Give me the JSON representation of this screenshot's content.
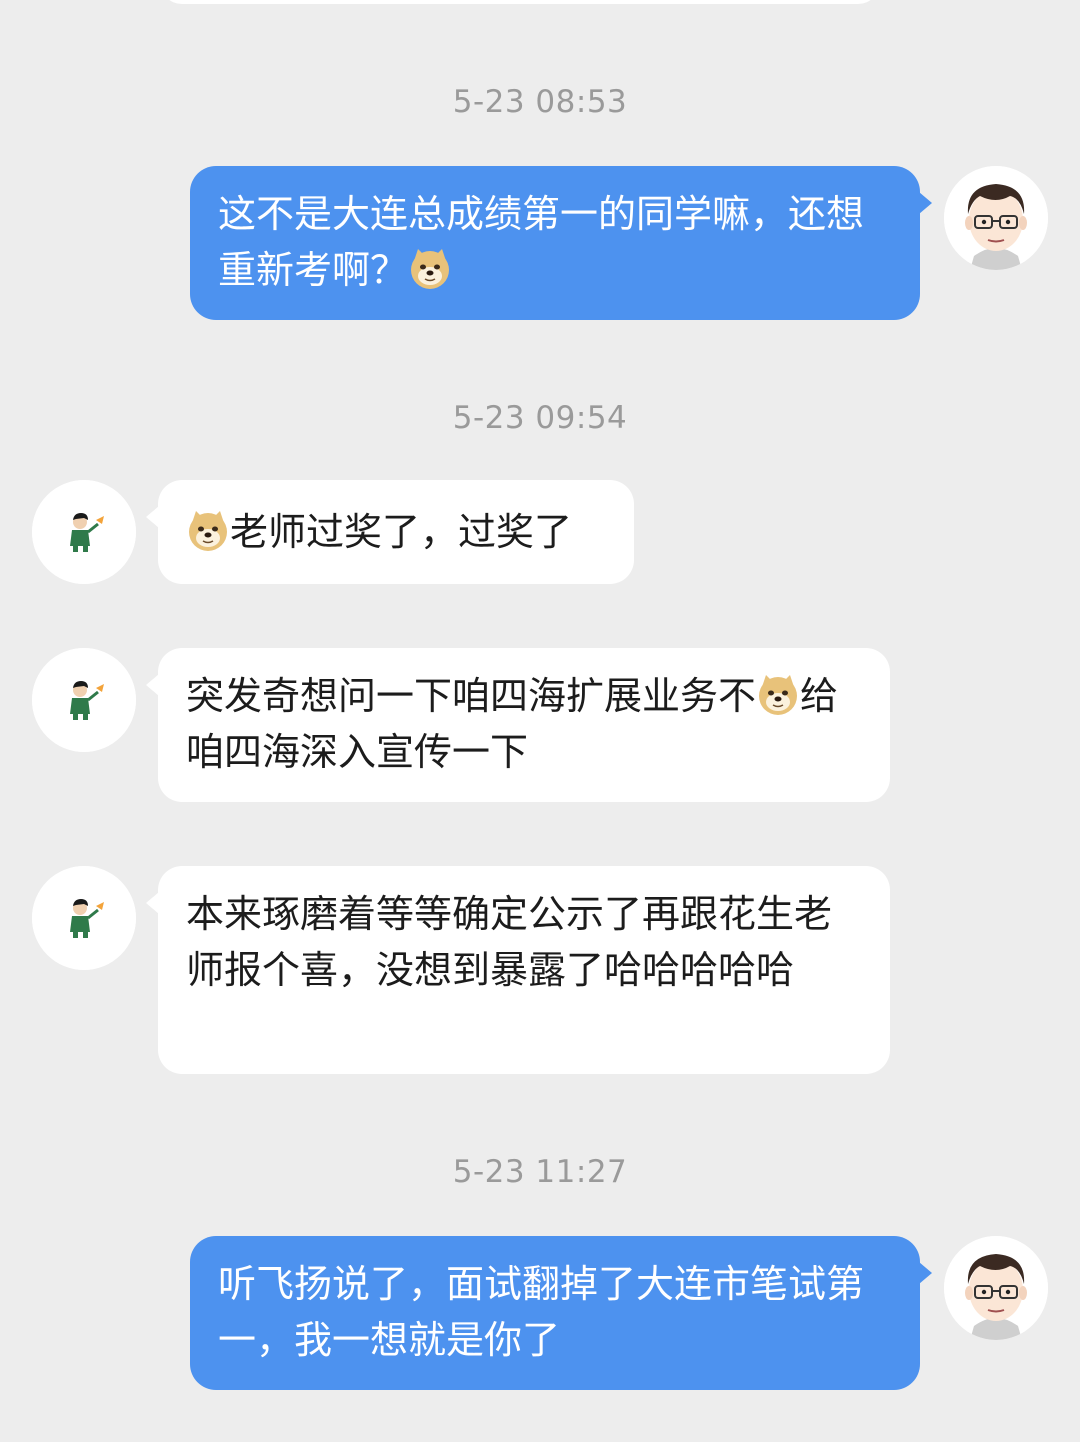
{
  "messages": [
    {
      "type": "timestamp",
      "text": "5-23 08:53"
    },
    {
      "type": "outgoing",
      "sender_icon": "teacher-avatar",
      "text_before": "这不是大连总成绩第一的同学嘛，还想重新考啊？",
      "emoji": "doge-emoji"
    },
    {
      "type": "timestamp",
      "text": "5-23 09:54"
    },
    {
      "type": "incoming",
      "sender_icon": "student-avatar",
      "emoji": "doge-emoji",
      "text_after": "老师过奖了，过奖了"
    },
    {
      "type": "incoming",
      "sender_icon": "student-avatar",
      "text_before": "突发奇想问一下咱四海扩展业务不",
      "emoji": "doge-emoji",
      "text_after": "给咱四海深入宣传一下"
    },
    {
      "type": "incoming",
      "sender_icon": "student-avatar",
      "text": "本来琢磨着等等确定公示了再跟花生老师报个喜，没想到暴露了哈哈哈哈哈"
    },
    {
      "type": "timestamp",
      "text": "5-23 11:27"
    },
    {
      "type": "outgoing",
      "sender_icon": "teacher-avatar",
      "text": "听飞扬说了，面试翻掉了大连市笔试第一，我一想就是你了"
    }
  ],
  "colors": {
    "background": "#ededed",
    "outgoing_bubble": "#4d92ef",
    "incoming_bubble": "#ffffff",
    "timestamp_text": "#9a9a9a"
  }
}
